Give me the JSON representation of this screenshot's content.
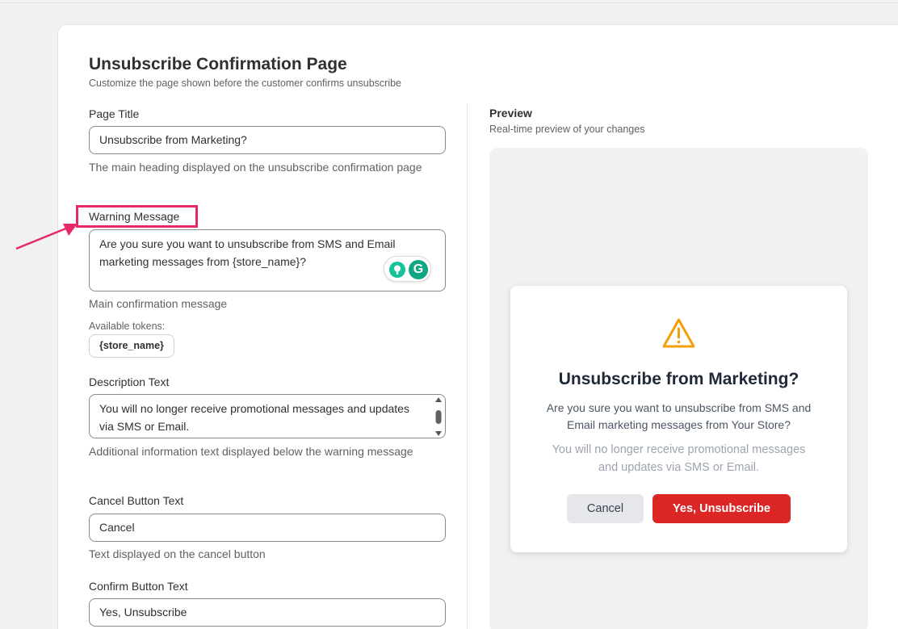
{
  "page": {
    "title": "Unsubscribe Confirmation Page",
    "subtitle": "Customize the page shown before the customer confirms unsubscribe"
  },
  "form": {
    "page_title": {
      "label": "Page Title",
      "value": "Unsubscribe from Marketing?",
      "help": "The main heading displayed on the unsubscribe confirmation page"
    },
    "warning_message": {
      "label": "Warning Message",
      "value": "Are you sure you want to unsubscribe from SMS and Email marketing messages from {store_name}?",
      "help": "Main confirmation message",
      "tokens_label": "Available tokens:",
      "tokens": [
        "{store_name}"
      ]
    },
    "description_text": {
      "label": "Description Text",
      "value": "You will no longer receive promotional messages and updates via SMS or Email.",
      "help": "Additional information text displayed below the warning message"
    },
    "cancel_button_text": {
      "label": "Cancel Button Text",
      "value": "Cancel",
      "help": "Text displayed on the cancel button"
    },
    "confirm_button_text": {
      "label": "Confirm Button Text",
      "value": "Yes, Unsubscribe"
    }
  },
  "preview": {
    "title": "Preview",
    "subtitle": "Real-time preview of your changes",
    "modal": {
      "icon": "warning-triangle-icon",
      "heading": "Unsubscribe from Marketing?",
      "message": "Are you sure you want to unsubscribe from SMS and Email marketing messages from Your Store?",
      "description": "You will no longer receive promotional messages and updates via SMS or Email.",
      "cancel_label": "Cancel",
      "confirm_label": "Yes, Unsubscribe"
    }
  },
  "colors": {
    "annotation": "#e6286a",
    "confirm_button": "#dc2626",
    "warning_icon": "#f59e0b",
    "grammarly": "#15c39a"
  }
}
